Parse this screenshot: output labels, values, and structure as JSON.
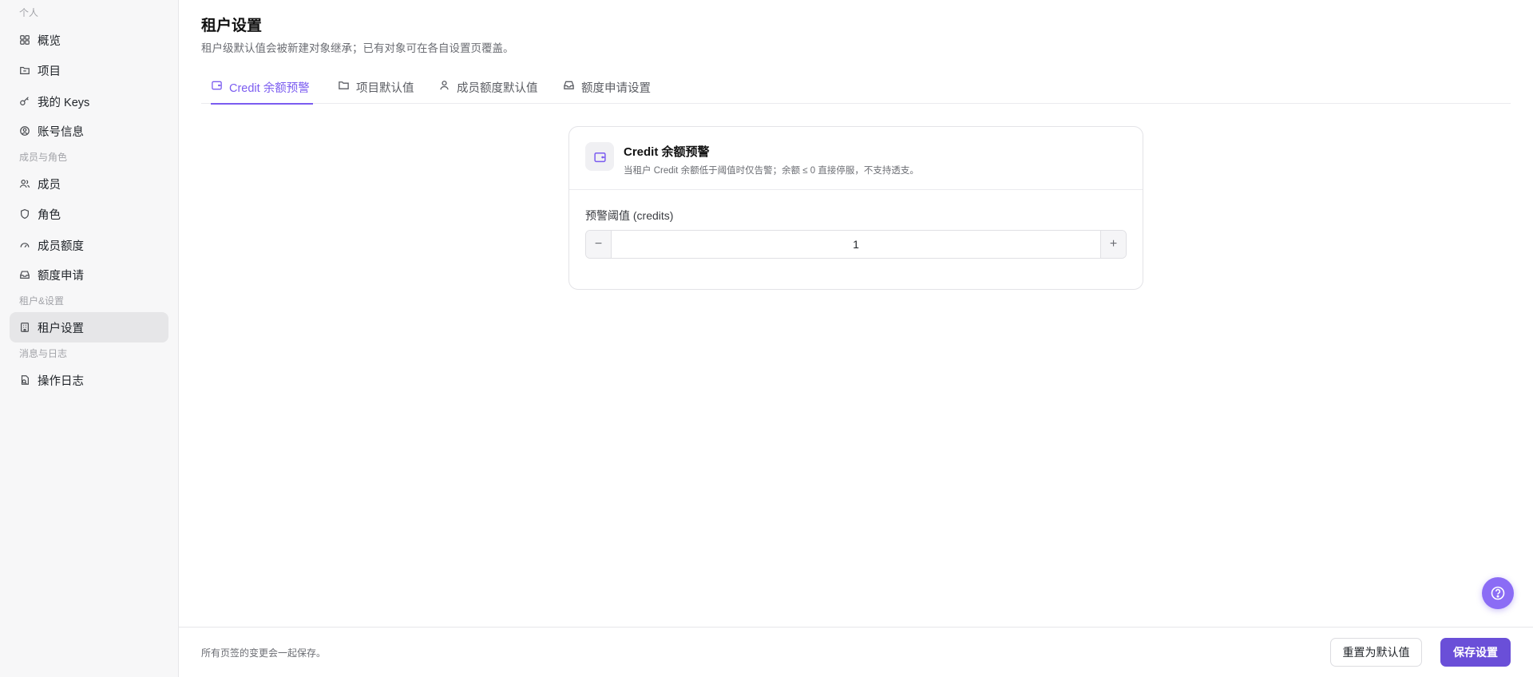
{
  "sidebar": {
    "groups": [
      {
        "label": "个人"
      },
      {
        "label": "成员与角色"
      },
      {
        "label": "租户&设置"
      },
      {
        "label": "消息与日志"
      }
    ],
    "items": [
      {
        "label": "概览",
        "icon": "grid-icon"
      },
      {
        "label": "项目",
        "icon": "folder-icon"
      },
      {
        "label": "我的 Keys",
        "icon": "key-icon"
      },
      {
        "label": "账号信息",
        "icon": "user-circle-icon"
      },
      {
        "label": "成员",
        "icon": "users-icon"
      },
      {
        "label": "角色",
        "icon": "shield-icon"
      },
      {
        "label": "成员额度",
        "icon": "gauge-icon"
      },
      {
        "label": "额度申请",
        "icon": "inbox-icon"
      },
      {
        "label": "租户设置",
        "icon": "building-icon",
        "active": true
      },
      {
        "label": "操作日志",
        "icon": "log-icon"
      }
    ]
  },
  "header": {
    "title": "租户设置",
    "subtitle": "租户级默认值会被新建对象继承；已有对象可在各自设置页覆盖。"
  },
  "tabs": [
    {
      "label": "Credit 余额预警",
      "icon": "wallet-icon",
      "active": true
    },
    {
      "label": "项目默认值",
      "icon": "folder-icon"
    },
    {
      "label": "成员额度默认值",
      "icon": "user-icon"
    },
    {
      "label": "额度申请设置",
      "icon": "inbox-icon"
    }
  ],
  "card": {
    "title": "Credit 余额预警",
    "description": "当租户 Credit 余额低于阈值时仅告警；余额 ≤ 0 直接停服，不支持透支。",
    "field_label": "预警阈值 (credits)",
    "threshold_value": "1",
    "minus_symbol": "−",
    "plus_symbol": "+"
  },
  "footer": {
    "note": "所有页签的变更会一起保存。",
    "reset_label": "重置为默认值",
    "save_label": "保存设置"
  },
  "colors": {
    "accent": "#7b5cf0",
    "primary_button": "#6a4fd8",
    "active_nav_bg": "#e6e6e8"
  }
}
